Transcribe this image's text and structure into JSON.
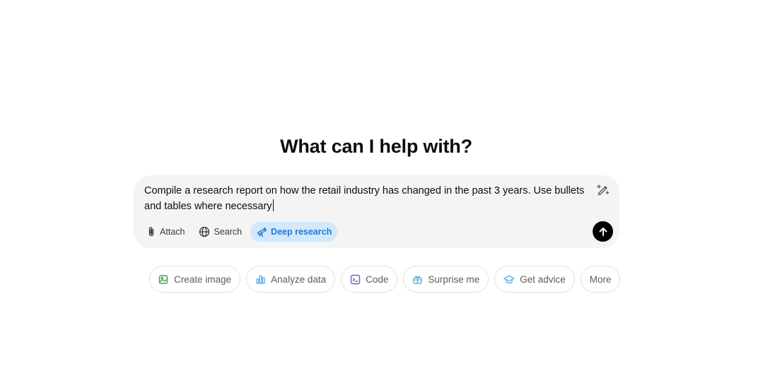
{
  "heading": "What can I help with?",
  "composer": {
    "prompt_text": "Compile a research report on how the retail industry has changed in the past 3 years. Use bullets and tables where necessary",
    "tools": [
      {
        "label": "Attach",
        "icon": "paperclip-icon",
        "active": false
      },
      {
        "label": "Search",
        "icon": "globe-icon",
        "active": false
      },
      {
        "label": "Deep research",
        "icon": "telescope-icon",
        "active": true,
        "color": "#1f7ad6"
      }
    ],
    "pen_icon": "magic-pen-icon",
    "send_icon": "arrow-up-icon"
  },
  "suggestions": [
    {
      "label": "Create image",
      "icon": "image-icon",
      "color": "#34a853"
    },
    {
      "label": "Analyze data",
      "icon": "bar-chart-icon",
      "color": "#5ab4e6"
    },
    {
      "label": "Code",
      "icon": "terminal-icon",
      "color": "#6b5bd6"
    },
    {
      "label": "Surprise me",
      "icon": "gift-icon",
      "color": "#5ab4e6"
    },
    {
      "label": "Get advice",
      "icon": "graduation-cap-icon",
      "color": "#5ab4e6"
    },
    {
      "label": "More",
      "icon": "",
      "color": ""
    }
  ]
}
